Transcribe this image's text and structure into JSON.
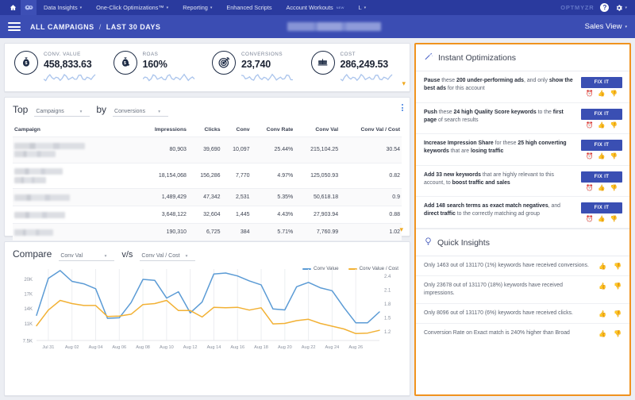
{
  "topnav": {
    "home_icon": "home-icon",
    "logo_icon": "optmyzr-logo-icon",
    "items": [
      {
        "label": "Data Insights",
        "has_caret": true,
        "is_new": false
      },
      {
        "label": "One-Click Optimizations™",
        "has_caret": true,
        "is_new": false
      },
      {
        "label": "Reporting",
        "has_caret": true,
        "is_new": false
      },
      {
        "label": "Enhanced Scripts",
        "has_caret": false,
        "is_new": false
      },
      {
        "label": "Account Workouts",
        "has_caret": false,
        "is_new": true,
        "new_badge": "NEW"
      },
      {
        "label": "L",
        "has_caret": true,
        "is_new": false
      }
    ],
    "brand": "OPTMYZR",
    "help_label": "?",
    "settings_icon": "gear-icon"
  },
  "subheader": {
    "menu_icon": "hamburger-menu-icon",
    "breadcrumb_account": "ALL CAMPAIGNS",
    "breadcrumb_sep": "/",
    "breadcrumb_range": "LAST 30 DAYS",
    "account_name_redacted": "",
    "view_selector": "Sales View",
    "view_caret": "▾"
  },
  "kpis": [
    {
      "label": "CONV. VALUE",
      "value": "458,833.63",
      "icon": "money-bag-icon"
    },
    {
      "label": "ROAS",
      "value": "160%",
      "icon": "money-bag-return-icon"
    },
    {
      "label": "CONVERSIONS",
      "value": "23,740",
      "icon": "target-dart-icon"
    },
    {
      "label": "COST",
      "value": "286,249.53",
      "icon": "balance-scale-icon"
    }
  ],
  "kpi_expand_icon": "chevron-down-icon",
  "top_table": {
    "prefix_label": "Top",
    "dimension_value": "Campaigns",
    "middle_label": "by",
    "metric_value": "Conversions",
    "menu_icon": "kebab-menu-icon",
    "expand_icon": "chevron-down-icon",
    "columns": [
      "Campaign",
      "Impressions",
      "Clicks",
      "Conv",
      "Conv Rate",
      "Conv Val",
      "Conv Val / Cost"
    ],
    "rows": [
      {
        "campaign": "",
        "campaign_redacted": true,
        "impressions": "80,903",
        "clicks": "39,690",
        "conv": "10,097",
        "conv_rate": "25.44%",
        "conv_val": "215,104.25",
        "conv_val_cost": "30.54"
      },
      {
        "campaign": "",
        "campaign_redacted": true,
        "impressions": "18,154,068",
        "clicks": "156,286",
        "conv": "7,770",
        "conv_rate": "4.97%",
        "conv_val": "125,050.93",
        "conv_val_cost": "0.82"
      },
      {
        "campaign": "",
        "campaign_redacted": true,
        "impressions": "1,489,429",
        "clicks": "47,342",
        "conv": "2,531",
        "conv_rate": "5.35%",
        "conv_val": "50,618.18",
        "conv_val_cost": "0.9"
      },
      {
        "campaign": "",
        "campaign_redacted": true,
        "impressions": "3,648,122",
        "clicks": "32,604",
        "conv": "1,445",
        "conv_rate": "4.43%",
        "conv_val": "27,903.94",
        "conv_val_cost": "0.88"
      },
      {
        "campaign": "",
        "campaign_redacted": true,
        "impressions": "190,310",
        "clicks": "6,725",
        "conv": "384",
        "conv_rate": "5.71%",
        "conv_val": "7,760.99",
        "conv_val_cost": "1.02"
      }
    ]
  },
  "compare": {
    "prefix_label": "Compare",
    "metric_a": "Conv Val",
    "vs_label": "v/s",
    "metric_b": "Conv Val / Cost"
  },
  "chart_data": {
    "type": "line",
    "title": "",
    "xlabel": "",
    "ylabel": "",
    "grid": true,
    "legend_position": "top-right",
    "x": [
      "Jul 30",
      "Jul 31",
      "Aug 01",
      "Aug 02",
      "Aug 03",
      "Aug 04",
      "Aug 05",
      "Aug 06",
      "Aug 07",
      "Aug 08",
      "Aug 09",
      "Aug 10",
      "Aug 11",
      "Aug 12",
      "Aug 13",
      "Aug 14",
      "Aug 15",
      "Aug 16",
      "Aug 17",
      "Aug 18",
      "Aug 19",
      "Aug 20",
      "Aug 21",
      "Aug 22",
      "Aug 23",
      "Aug 24",
      "Aug 25",
      "Aug 26",
      "Aug 27",
      "Aug 28"
    ],
    "xticks": [
      "Jul 31",
      "Aug 02",
      "Aug 04",
      "Aug 06",
      "Aug 08",
      "Aug 10",
      "Aug 12",
      "Aug 14",
      "Aug 16",
      "Aug 18",
      "Aug 20",
      "Aug 22",
      "Aug 24",
      "Aug 26"
    ],
    "yticks_left": [
      "7.5K",
      "11K",
      "14K",
      "17K",
      "20K"
    ],
    "ylim_left": [
      7500,
      22000
    ],
    "yticks_right": [
      "1.2",
      "1.5",
      "1.8",
      "2.1",
      "2.4"
    ],
    "ylim_right": [
      1.0,
      2.55
    ],
    "series": [
      {
        "name": "Conv Value",
        "color": "#5b9bd5",
        "axis": "left",
        "values": [
          12600,
          20100,
          21700,
          19500,
          19000,
          18000,
          12000,
          12100,
          15200,
          19900,
          19700,
          16100,
          17400,
          13100,
          15300,
          21000,
          21200,
          20600,
          19600,
          18800,
          13900,
          13700,
          18400,
          19300,
          18200,
          17600,
          14200,
          11100,
          11100,
          13300
        ]
      },
      {
        "name": "Conv Value / Cost",
        "color": "#f2b134",
        "axis": "right",
        "values": [
          1.32,
          1.66,
          1.87,
          1.8,
          1.76,
          1.76,
          1.52,
          1.53,
          1.57,
          1.78,
          1.8,
          1.87,
          1.65,
          1.65,
          1.51,
          1.72,
          1.71,
          1.72,
          1.66,
          1.71,
          1.36,
          1.37,
          1.43,
          1.46,
          1.37,
          1.31,
          1.25,
          1.15,
          1.16,
          1.22
        ]
      }
    ]
  },
  "instant_optimizations": {
    "icon": "magic-wand-icon",
    "title": "Instant Optimizations",
    "items": [
      {
        "parts": [
          {
            "t": "Pause",
            "b": true
          },
          {
            "t": " these ",
            "b": false
          },
          {
            "t": "200 under-performing ads",
            "b": true
          },
          {
            "t": ", and only ",
            "b": false
          },
          {
            "t": "show the best ads",
            "b": true
          },
          {
            "t": " for this account",
            "b": false
          }
        ],
        "button": "FIX IT"
      },
      {
        "parts": [
          {
            "t": "Push",
            "b": true
          },
          {
            "t": " these ",
            "b": false
          },
          {
            "t": "24 high Quality Score keywords",
            "b": true
          },
          {
            "t": " to the ",
            "b": false
          },
          {
            "t": "first page",
            "b": true
          },
          {
            "t": " of search results",
            "b": false
          }
        ],
        "button": "FIX IT"
      },
      {
        "parts": [
          {
            "t": "Increase Impression Share",
            "b": true
          },
          {
            "t": " for these ",
            "b": false
          },
          {
            "t": "25 high converting keywords",
            "b": true
          },
          {
            "t": " that are ",
            "b": false
          },
          {
            "t": "losing traffic",
            "b": true
          }
        ],
        "button": "FIX IT"
      },
      {
        "parts": [
          {
            "t": "Add 33 new keywords",
            "b": true
          },
          {
            "t": " that are highly relevant to this account, to ",
            "b": false
          },
          {
            "t": "boost traffic and sales",
            "b": true
          }
        ],
        "button": "FIX IT"
      },
      {
        "parts": [
          {
            "t": "Add 148 search terms as exact match negatives",
            "b": true
          },
          {
            "t": ", and ",
            "b": false
          },
          {
            "t": "direct traffic",
            "b": true
          },
          {
            "t": " to the correctly matching ad group",
            "b": false
          }
        ],
        "button": "FIX IT"
      }
    ],
    "reactions": [
      {
        "icon": "snooze-alarm-icon",
        "glyph": "⏰",
        "cls": "ico-snooze"
      },
      {
        "icon": "thumbs-up-icon",
        "glyph": "👍",
        "cls": "ico-up"
      },
      {
        "icon": "thumbs-down-icon",
        "glyph": "👎",
        "cls": "ico-down"
      }
    ]
  },
  "quick_insights": {
    "icon": "lightbulb-icon",
    "title": "Quick Insights",
    "items": [
      {
        "text": "Only 1463 out of 131170 (1%) keywords have received conversions."
      },
      {
        "text": "Only 23678 out of 131170 (18%) keywords have received impressions."
      },
      {
        "text": "Only 8096 out of 131170 (6%) keywords have received clicks."
      },
      {
        "text": "Conversion Rate on Exact match is 240% higher than Broad"
      }
    ],
    "reactions": [
      {
        "icon": "thumbs-up-icon",
        "glyph": "👍",
        "cls": "ico-up"
      },
      {
        "icon": "thumbs-down-icon",
        "glyph": "👎",
        "cls": "ico-down"
      }
    ]
  },
  "colors": {
    "nav_dark": "#2a3a9e",
    "nav_mid": "#3b4db3",
    "accent_orange": "#f0931f",
    "button_blue": "#3a4fb3",
    "series_blue": "#5b9bd5",
    "series_yellow": "#f2b134"
  }
}
